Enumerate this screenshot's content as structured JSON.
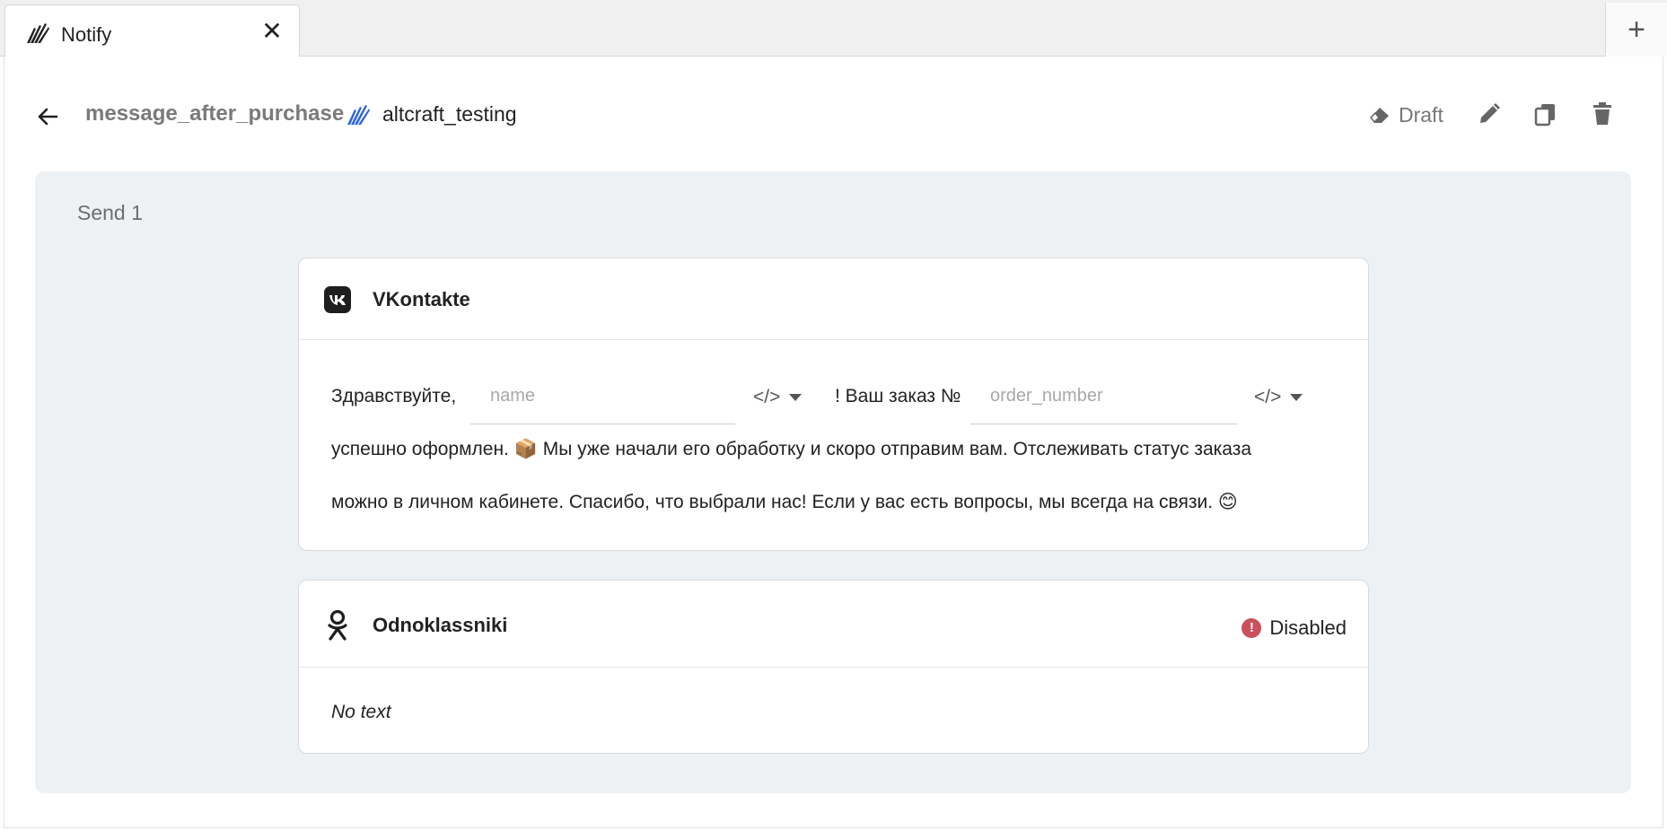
{
  "tab": {
    "label": "Notify",
    "close": "✕"
  },
  "add_tab": "+",
  "header": {
    "message_name": "message_after_purchase",
    "project_name": "altcraft_testing",
    "status": "Draft"
  },
  "panel": {
    "send_label": "Send 1"
  },
  "vk_card": {
    "title": "VKontakte",
    "text_greeting": "Здравствуйте,",
    "var1_placeholder": "name",
    "text_order": "! Ваш заказ №",
    "var2_placeholder": "order_number",
    "code_label": "</>",
    "text_line2": "успешно оформлен. 📦 Мы уже начали его обработку и скоро отправим вам. Отслеживать статус заказа",
    "text_line3": "можно в личном кабинете. Спасибо, что выбрали нас! Если у вас есть вопросы, мы всегда на связи. 😊"
  },
  "ok_card": {
    "title": "Odnoklassniki",
    "status": "Disabled",
    "status_mark": "!",
    "body": "No text"
  },
  "colors": {
    "panel_bg": "#eef1f4",
    "disabled": "#c9505c",
    "brand_blue": "#2a64d8"
  }
}
